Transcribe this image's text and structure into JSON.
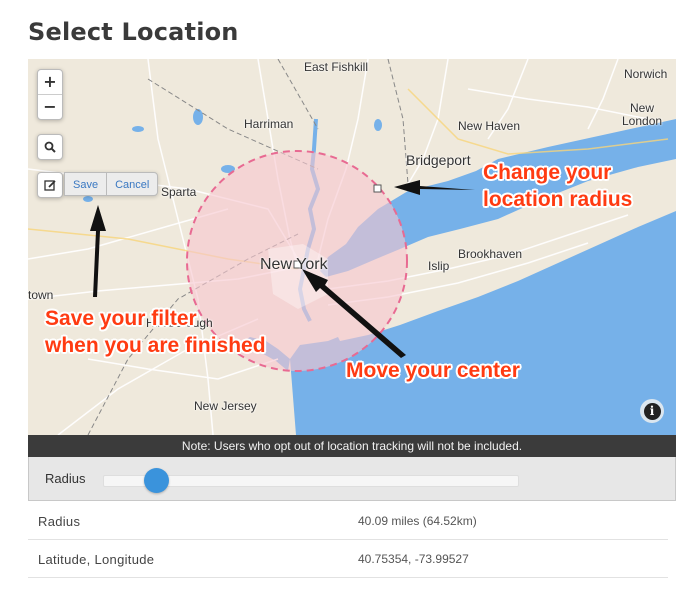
{
  "page": {
    "title": "Select Location"
  },
  "map": {
    "labels": {
      "east_fishkill": "East Fishkill",
      "norwich": "Norwich",
      "harriman": "Harriman",
      "new_haven": "New Haven",
      "new_london": "New\nLondon",
      "bridgeport": "Bridgeport",
      "sparta": "Sparta",
      "brookhaven": "Brookhaven",
      "islip": "Islip",
      "new_york": "New York",
      "town": "town",
      "hillsborough": "Hillsborough",
      "new_jersey": "New Jersey"
    },
    "controls": {
      "zoom_in": "+",
      "zoom_out": "−",
      "search_icon": "search-icon",
      "edit_icon": "edit-icon",
      "save_label": "Save",
      "cancel_label": "Cancel",
      "info_label": "i"
    },
    "colors": {
      "water": "#76b1e9",
      "land": "#efe9dc",
      "radius_fill": "#f6c6cf",
      "radius_stroke": "#e86a92"
    }
  },
  "annotations": {
    "radius": "Change your\nlocation radius",
    "save": "Save your filter\nwhen you are finished",
    "center": "Move your center"
  },
  "note": "Note: Users who opt out of location tracking will not be included.",
  "radius_control": {
    "label": "Radius",
    "value_fraction": 0.125
  },
  "details": {
    "rows": [
      {
        "key": "Radius",
        "value": "40.09 miles (64.52km)"
      },
      {
        "key": "Latitude, Longitude",
        "value": "40.75354, -73.99527"
      }
    ]
  }
}
